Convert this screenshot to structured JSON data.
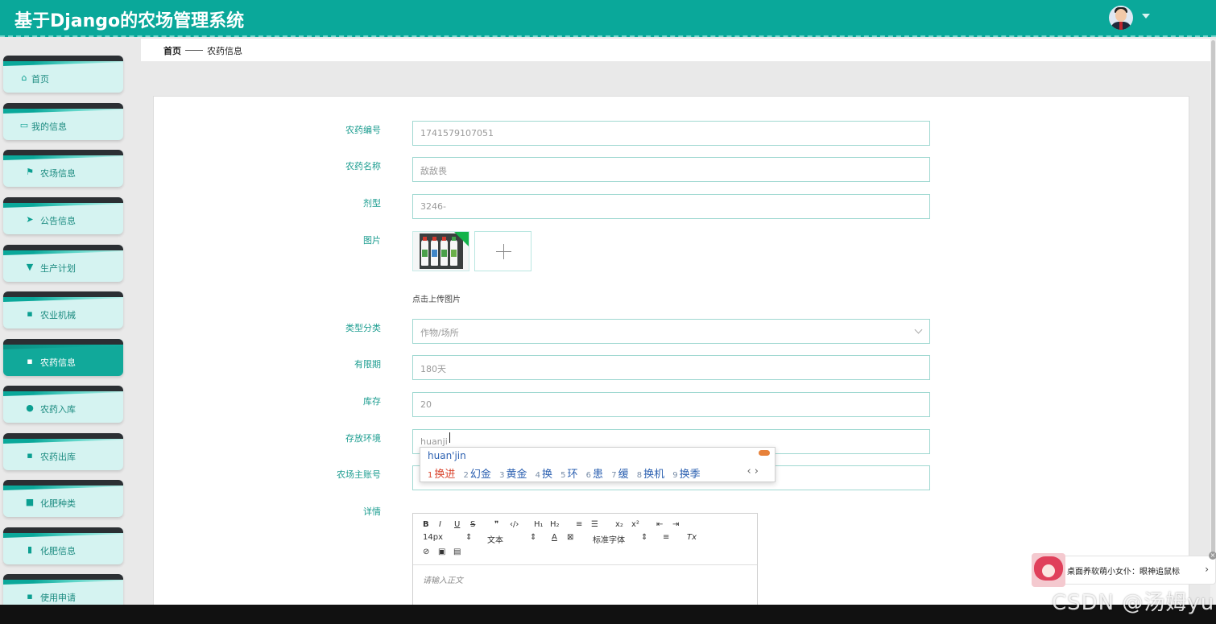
{
  "app": {
    "title": "基于Django的农场管理系统"
  },
  "sidebar": {
    "items": [
      {
        "label": "首页",
        "icon": "home-icon",
        "glyph": "⌂"
      },
      {
        "label": "我的信息",
        "icon": "profile-card-icon",
        "glyph": "▭"
      },
      {
        "label": "农场信息",
        "icon": "flag-icon",
        "glyph": "⚑"
      },
      {
        "label": "公告信息",
        "icon": "send-icon",
        "glyph": "➤"
      },
      {
        "label": "生产计划",
        "icon": "brush-icon",
        "glyph": "▼"
      },
      {
        "label": "农业机械",
        "icon": "grid-icon",
        "glyph": "▪"
      },
      {
        "label": "农药信息",
        "icon": "grid-icon",
        "glyph": "▪"
      },
      {
        "label": "农药入库",
        "icon": "user-icon",
        "glyph": "●"
      },
      {
        "label": "农药出库",
        "icon": "grid-icon",
        "glyph": "▪"
      },
      {
        "label": "化肥种类",
        "icon": "video-icon",
        "glyph": "■"
      },
      {
        "label": "化肥信息",
        "icon": "clipboard-icon",
        "glyph": "▮"
      },
      {
        "label": "使用申请",
        "icon": "grid-icon",
        "glyph": "▪"
      }
    ],
    "active": "农药信息"
  },
  "breadcrumb": {
    "home": "首页",
    "current": "农药信息"
  },
  "form": {
    "code_label": "农药编号",
    "code_value": "1741579107051",
    "name_label": "农药名称",
    "name_value": "敌敌畏",
    "form_label": "剂型",
    "form_value": "3246-",
    "image_label": "图片",
    "upload_tip": "点击上传图片",
    "category_label": "类型分类",
    "category_value": "作物/场所",
    "expiry_label": "有限期",
    "expiry_value": "180天",
    "stock_label": "库存",
    "stock_value": "20",
    "env_label": "存放环境",
    "env_value": "huanji",
    "account_label": "农场主账号",
    "detail_label": "详情"
  },
  "ime": {
    "composition": "huan'jin",
    "candidates": [
      {
        "n": "1",
        "text": "换进"
      },
      {
        "n": "2",
        "text": "幻金"
      },
      {
        "n": "3",
        "text": "黄金"
      },
      {
        "n": "4",
        "text": "换"
      },
      {
        "n": "5",
        "text": "环"
      },
      {
        "n": "6",
        "text": "患"
      },
      {
        "n": "7",
        "text": "缓"
      },
      {
        "n": "8",
        "text": "换机"
      },
      {
        "n": "9",
        "text": "换季"
      }
    ]
  },
  "editor": {
    "font_size": "14px",
    "paragraph": "文本",
    "font_family": "标准字体",
    "placeholder": "请输入正文",
    "buttons": [
      "B",
      "I",
      "U",
      "S",
      "❞",
      "‹/›",
      "H₁",
      "H₂",
      "≡",
      "☰",
      "x₂",
      "x²",
      "⇤",
      "⇥",
      "A",
      "⊠",
      "≡",
      "Tx",
      "⊘",
      "▣",
      "▤"
    ]
  },
  "widget": {
    "text": "桌面养软萌小女仆：眼神追鼠标"
  },
  "watermark": "CSDN @汤姆yu",
  "colors": {
    "primary": "#0aa89a",
    "label": "#1c9d90",
    "menu_bg": "#d5f3f1"
  }
}
